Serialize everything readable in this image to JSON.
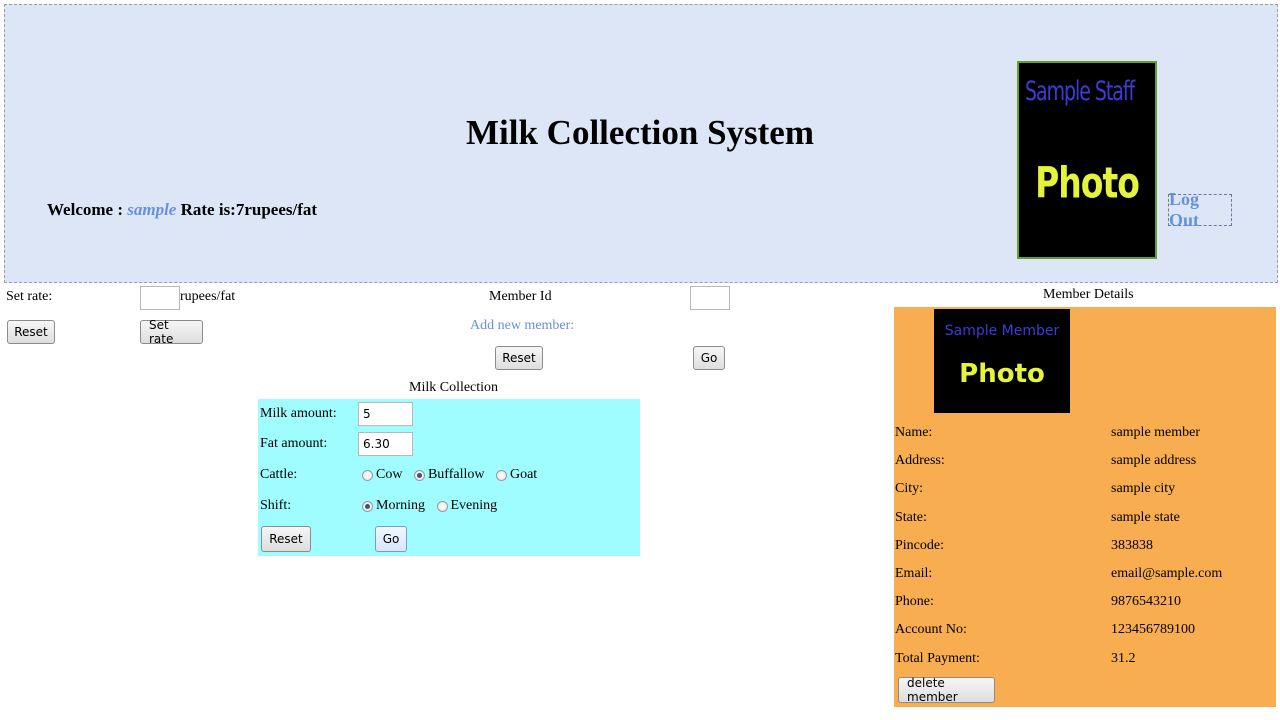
{
  "header": {
    "title": "Milk Collection System",
    "welcome_label": "Welcome :",
    "username": "sample",
    "rate_text": "Rate is:7rupees/fat",
    "staff_photo": {
      "line1": "Sample Staff",
      "line2": "Photo"
    },
    "logout": "Log Out"
  },
  "rate_panel": {
    "set_rate_label": "Set rate:",
    "rate_value": "",
    "unit_label": "rupees/fat",
    "reset_button": "Reset",
    "set_rate_button": "Set rate"
  },
  "member_panel": {
    "member_id_label": "Member Id",
    "member_id_value": "",
    "add_new_member": "Add new member:",
    "reset_button": "Reset",
    "go_button": "Go"
  },
  "milk_collection": {
    "title": "Milk Collection",
    "milk_amount_label": "Milk amount:",
    "milk_amount_value": "5",
    "fat_amount_label": "Fat amount:",
    "fat_amount_value": "6.30",
    "cattle_label": "Cattle:",
    "cattle_options": [
      "Cow",
      "Buffallow",
      "Goat"
    ],
    "cattle_selected": "Buffallow",
    "shift_label": "Shift:",
    "shift_options": [
      "Morning",
      "Evening"
    ],
    "shift_selected": "Morning",
    "reset_button": "Reset",
    "go_button": "Go"
  },
  "member_details": {
    "title": "Member Details",
    "photo": {
      "line1": "Sample Member",
      "line2": "Photo"
    },
    "fields": [
      {
        "label": "Name:",
        "value": "sample member"
      },
      {
        "label": "Address:",
        "value": "sample address"
      },
      {
        "label": "City:",
        "value": "sample city"
      },
      {
        "label": "State:",
        "value": "sample state"
      },
      {
        "label": "Pincode:",
        "value": "383838"
      },
      {
        "label": "Email:",
        "value": "email@sample.com"
      },
      {
        "label": "Phone:",
        "value": "9876543210"
      },
      {
        "label": "Account No:",
        "value": "123456789100"
      },
      {
        "label": "Total Payment:",
        "value": "31.2"
      }
    ],
    "delete_button": "delete member"
  },
  "colors": {
    "header_bg": "#dde6f6",
    "link": "#6691e0",
    "collection_bg": "#9ffcff",
    "details_bg": "#f7ad50",
    "photo_text_staff": "#3d3bd9",
    "photo_text_main": "#e5f43a"
  }
}
